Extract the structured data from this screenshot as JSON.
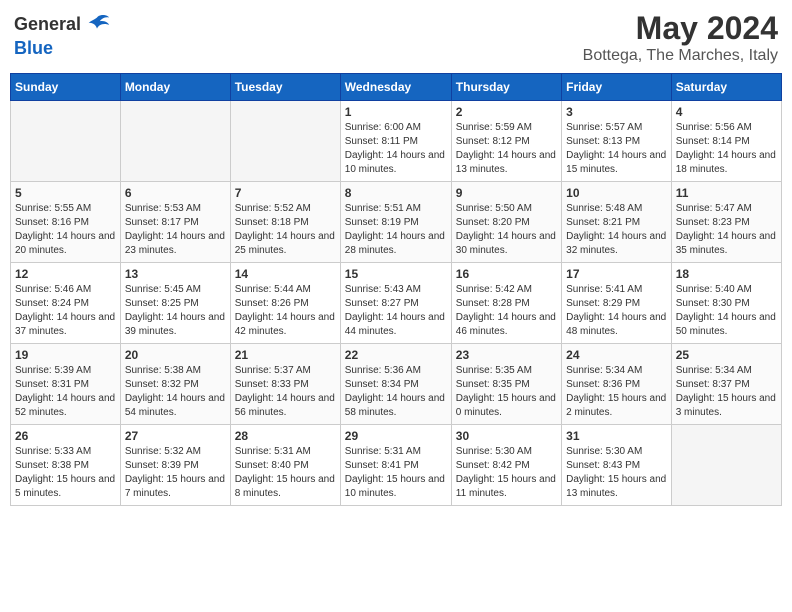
{
  "header": {
    "logo_general": "General",
    "logo_blue": "Blue",
    "month": "May 2024",
    "location": "Bottega, The Marches, Italy"
  },
  "weekdays": [
    "Sunday",
    "Monday",
    "Tuesday",
    "Wednesday",
    "Thursday",
    "Friday",
    "Saturday"
  ],
  "weeks": [
    [
      {
        "day": "",
        "info": ""
      },
      {
        "day": "",
        "info": ""
      },
      {
        "day": "",
        "info": ""
      },
      {
        "day": "1",
        "info": "Sunrise: 6:00 AM\nSunset: 8:11 PM\nDaylight: 14 hours\nand 10 minutes."
      },
      {
        "day": "2",
        "info": "Sunrise: 5:59 AM\nSunset: 8:12 PM\nDaylight: 14 hours\nand 13 minutes."
      },
      {
        "day": "3",
        "info": "Sunrise: 5:57 AM\nSunset: 8:13 PM\nDaylight: 14 hours\nand 15 minutes."
      },
      {
        "day": "4",
        "info": "Sunrise: 5:56 AM\nSunset: 8:14 PM\nDaylight: 14 hours\nand 18 minutes."
      }
    ],
    [
      {
        "day": "5",
        "info": "Sunrise: 5:55 AM\nSunset: 8:16 PM\nDaylight: 14 hours\nand 20 minutes."
      },
      {
        "day": "6",
        "info": "Sunrise: 5:53 AM\nSunset: 8:17 PM\nDaylight: 14 hours\nand 23 minutes."
      },
      {
        "day": "7",
        "info": "Sunrise: 5:52 AM\nSunset: 8:18 PM\nDaylight: 14 hours\nand 25 minutes."
      },
      {
        "day": "8",
        "info": "Sunrise: 5:51 AM\nSunset: 8:19 PM\nDaylight: 14 hours\nand 28 minutes."
      },
      {
        "day": "9",
        "info": "Sunrise: 5:50 AM\nSunset: 8:20 PM\nDaylight: 14 hours\nand 30 minutes."
      },
      {
        "day": "10",
        "info": "Sunrise: 5:48 AM\nSunset: 8:21 PM\nDaylight: 14 hours\nand 32 minutes."
      },
      {
        "day": "11",
        "info": "Sunrise: 5:47 AM\nSunset: 8:23 PM\nDaylight: 14 hours\nand 35 minutes."
      }
    ],
    [
      {
        "day": "12",
        "info": "Sunrise: 5:46 AM\nSunset: 8:24 PM\nDaylight: 14 hours\nand 37 minutes."
      },
      {
        "day": "13",
        "info": "Sunrise: 5:45 AM\nSunset: 8:25 PM\nDaylight: 14 hours\nand 39 minutes."
      },
      {
        "day": "14",
        "info": "Sunrise: 5:44 AM\nSunset: 8:26 PM\nDaylight: 14 hours\nand 42 minutes."
      },
      {
        "day": "15",
        "info": "Sunrise: 5:43 AM\nSunset: 8:27 PM\nDaylight: 14 hours\nand 44 minutes."
      },
      {
        "day": "16",
        "info": "Sunrise: 5:42 AM\nSunset: 8:28 PM\nDaylight: 14 hours\nand 46 minutes."
      },
      {
        "day": "17",
        "info": "Sunrise: 5:41 AM\nSunset: 8:29 PM\nDaylight: 14 hours\nand 48 minutes."
      },
      {
        "day": "18",
        "info": "Sunrise: 5:40 AM\nSunset: 8:30 PM\nDaylight: 14 hours\nand 50 minutes."
      }
    ],
    [
      {
        "day": "19",
        "info": "Sunrise: 5:39 AM\nSunset: 8:31 PM\nDaylight: 14 hours\nand 52 minutes."
      },
      {
        "day": "20",
        "info": "Sunrise: 5:38 AM\nSunset: 8:32 PM\nDaylight: 14 hours\nand 54 minutes."
      },
      {
        "day": "21",
        "info": "Sunrise: 5:37 AM\nSunset: 8:33 PM\nDaylight: 14 hours\nand 56 minutes."
      },
      {
        "day": "22",
        "info": "Sunrise: 5:36 AM\nSunset: 8:34 PM\nDaylight: 14 hours\nand 58 minutes."
      },
      {
        "day": "23",
        "info": "Sunrise: 5:35 AM\nSunset: 8:35 PM\nDaylight: 15 hours\nand 0 minutes."
      },
      {
        "day": "24",
        "info": "Sunrise: 5:34 AM\nSunset: 8:36 PM\nDaylight: 15 hours\nand 2 minutes."
      },
      {
        "day": "25",
        "info": "Sunrise: 5:34 AM\nSunset: 8:37 PM\nDaylight: 15 hours\nand 3 minutes."
      }
    ],
    [
      {
        "day": "26",
        "info": "Sunrise: 5:33 AM\nSunset: 8:38 PM\nDaylight: 15 hours\nand 5 minutes."
      },
      {
        "day": "27",
        "info": "Sunrise: 5:32 AM\nSunset: 8:39 PM\nDaylight: 15 hours\nand 7 minutes."
      },
      {
        "day": "28",
        "info": "Sunrise: 5:31 AM\nSunset: 8:40 PM\nDaylight: 15 hours\nand 8 minutes."
      },
      {
        "day": "29",
        "info": "Sunrise: 5:31 AM\nSunset: 8:41 PM\nDaylight: 15 hours\nand 10 minutes."
      },
      {
        "day": "30",
        "info": "Sunrise: 5:30 AM\nSunset: 8:42 PM\nDaylight: 15 hours\nand 11 minutes."
      },
      {
        "day": "31",
        "info": "Sunrise: 5:30 AM\nSunset: 8:43 PM\nDaylight: 15 hours\nand 13 minutes."
      },
      {
        "day": "",
        "info": ""
      }
    ]
  ]
}
